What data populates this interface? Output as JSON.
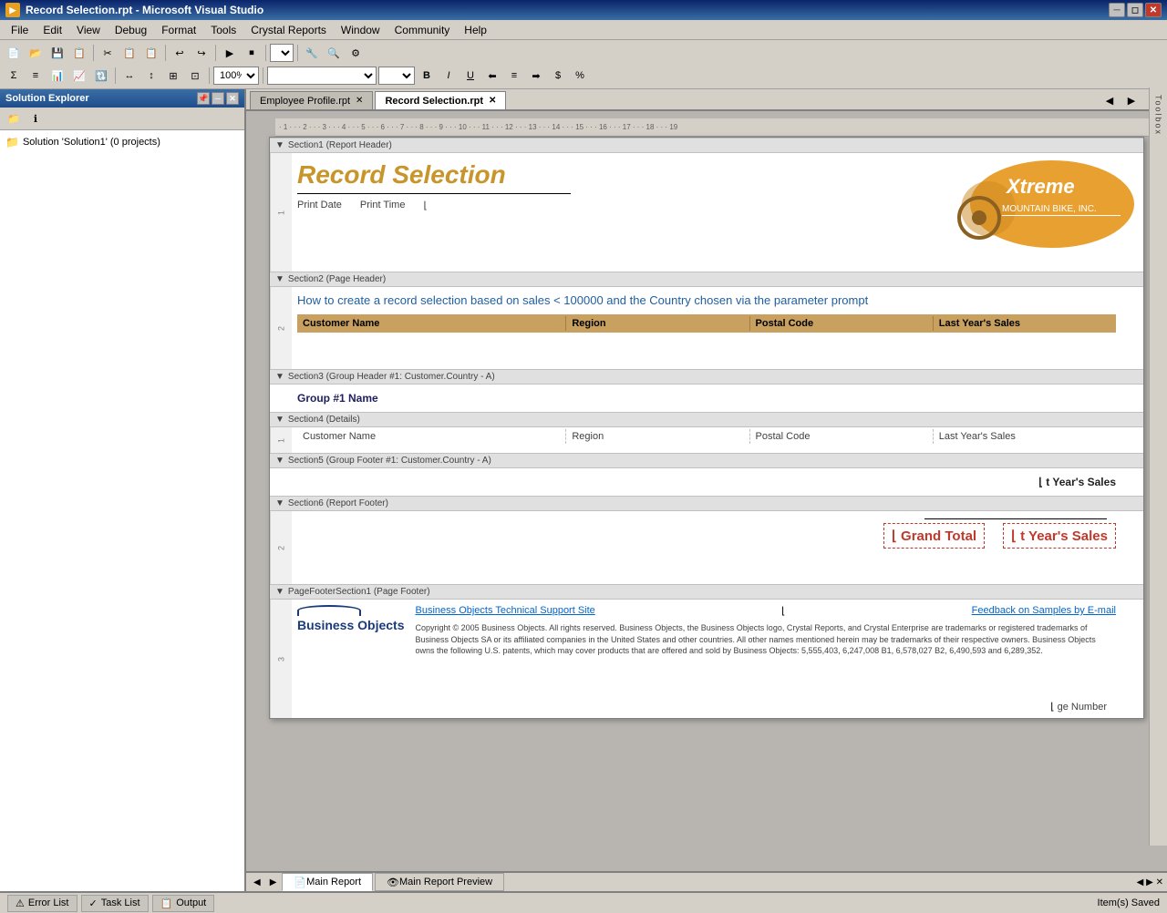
{
  "window": {
    "title": "Record Selection.rpt - Microsoft Visual Studio",
    "title_icon": "VS"
  },
  "menu": {
    "items": [
      "File",
      "Edit",
      "View",
      "Debug",
      "Format",
      "Tools",
      "Crystal Reports",
      "Window",
      "Community",
      "Help"
    ]
  },
  "toolbar": {
    "zoom_value": "100%",
    "font_combo": "",
    "size_combo": ""
  },
  "solution_explorer": {
    "title": "Solution Explorer",
    "tree": {
      "root": "Solution 'Solution1' (0 projects)"
    }
  },
  "tabs": {
    "items": [
      {
        "label": "Employee Profile.rpt",
        "active": false
      },
      {
        "label": "Record Selection.rpt",
        "active": true
      }
    ]
  },
  "report": {
    "sections": [
      {
        "id": "section1",
        "header": "Section1 (Report Header)",
        "num": "1",
        "type": "report-header"
      },
      {
        "id": "section2",
        "header": "Section2 (Page Header)",
        "num": "2",
        "type": "page-header"
      },
      {
        "id": "section3",
        "header": "Section3 (Group Header #1: Customer.Country - A)",
        "num": "",
        "type": "group-header"
      },
      {
        "id": "section4",
        "header": "Section4 (Details)",
        "num": "1",
        "type": "details"
      },
      {
        "id": "section5",
        "header": "Section5 (Group Footer #1: Customer.Country - A)",
        "num": "",
        "type": "group-footer"
      },
      {
        "id": "section6",
        "header": "Section6 (Report Footer)",
        "num": "2",
        "type": "report-footer"
      },
      {
        "id": "pagefooter",
        "header": "PageFooterSection1 (Page Footer)",
        "num": "3",
        "type": "page-footer"
      }
    ],
    "header": {
      "title": "Record Selection",
      "print_date_label": "Print Date",
      "print_time_label": "Print Time"
    },
    "page_header": {
      "subtitle": "How to create a record selection based on sales < 100000 and the Country chosen via the parameter prompt",
      "columns": [
        "Customer Name",
        "Region",
        "Postal Code",
        "Last Year's Sales"
      ]
    },
    "group_header": {
      "label": "Group #1 Name"
    },
    "details": {
      "columns": [
        "Customer Name",
        "Region",
        "Postal Code",
        "Last Year's Sales"
      ]
    },
    "group_footer": {
      "sum_label": "t Year's Sales"
    },
    "report_footer": {
      "grand_total_label": "Grand Total",
      "grand_total_value": "t Year's Sales",
      "underline": true
    },
    "page_footer": {
      "bo_logo": "Business Objects",
      "link1": "Business Objects Technical Support Site",
      "link2": "Feedback on Samples by E-mail",
      "copyright": "Copyright © 2005 Business Objects. All rights reserved. Business Objects, the Business Objects logo, Crystal Reports, and Crystal Enterprise are trademarks or registered trademarks of Business Objects SA or its affiliated companies in the United States and other countries.  All other names mentioned herein may be trademarks of their respective owners. Business Objects owns the following U.S. patents, which may cover products that are offered and sold by Business Objects: 5,555,403, 6,247,008 B1, 6,578,027 B2, 6,490,593 and 6,289,352.",
      "page_num_label": "ge Number"
    }
  },
  "bottom_tabs": {
    "items": [
      {
        "label": "Main Report",
        "active": true,
        "icon": "📄"
      },
      {
        "label": "Main Report Preview",
        "active": false,
        "icon": "👁"
      }
    ]
  },
  "status_bar": {
    "panels": [
      {
        "label": "Error List",
        "icon": "⚠"
      },
      {
        "label": "Task List",
        "icon": "✓"
      },
      {
        "label": "Output",
        "icon": "📋"
      }
    ],
    "status_text": "Item(s) Saved"
  },
  "toolbox": {
    "label": "Toolbox"
  }
}
